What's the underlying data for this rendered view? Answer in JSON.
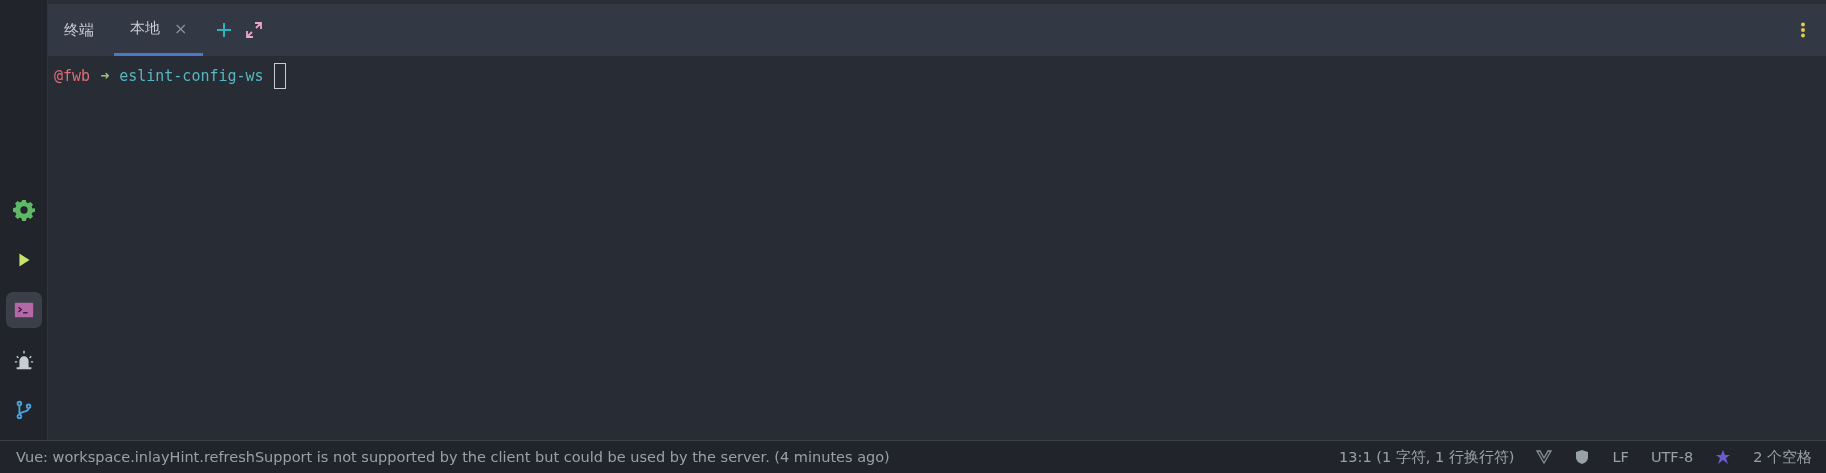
{
  "tool_window": {
    "title": "终端",
    "tabs": [
      {
        "label": "本地",
        "selected": true,
        "close": "×"
      }
    ]
  },
  "sidebar": {
    "items": [
      {
        "kind": "gear",
        "selected": false
      },
      {
        "kind": "run",
        "selected": false
      },
      {
        "kind": "terminal",
        "selected": true
      },
      {
        "kind": "alarm",
        "selected": false
      },
      {
        "kind": "branch",
        "selected": false
      }
    ]
  },
  "terminal": {
    "lines": [
      {
        "user": "@fwb",
        "arrow": "➜",
        "directory": "eslint-config-ws",
        "cursor": true
      }
    ]
  },
  "status_bar": {
    "message": "Vue: workspace.inlayHint.refreshSupport is not supported by the client but could be used by the server. (4 minutes ago)",
    "position": "13:1 (1 字符, 1 行换行符)",
    "line_separator": "LF",
    "encoding": "UTF-8",
    "indent": "2 个空格"
  }
}
